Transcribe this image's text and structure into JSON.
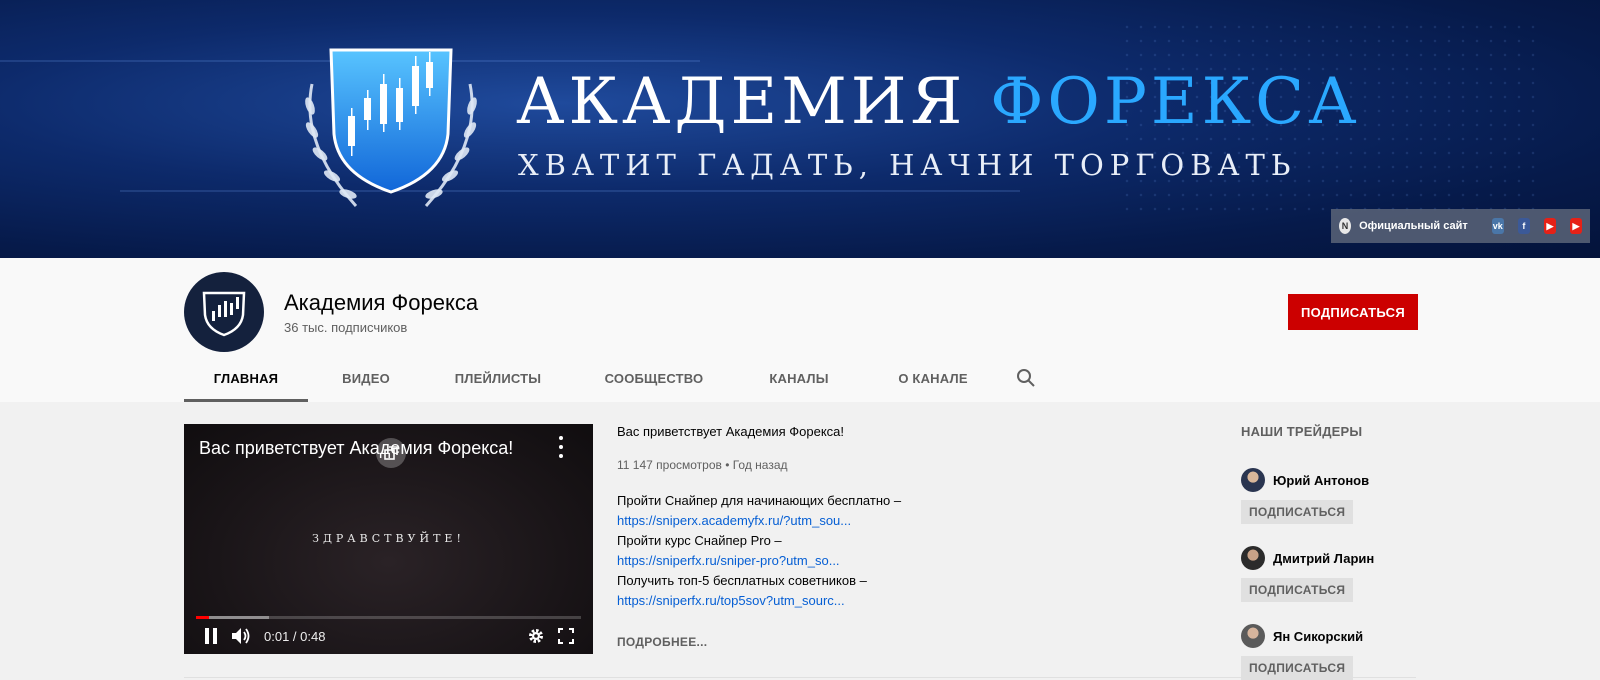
{
  "banner": {
    "title_part1": "АКАДЕМИЯ",
    "title_part2": "ФОРЕКСА",
    "slogan": "ХВАТИТ ГАДАТЬ, НАЧНИ ТОРГОВАТЬ",
    "links": {
      "official_site_label": "Официальный сайт",
      "icons": [
        "site-icon",
        "vk-icon",
        "facebook-icon",
        "youtube-icon",
        "youtube-icon"
      ]
    }
  },
  "channel": {
    "name": "Академия Форекса",
    "subscribers": "36 тыс. подписчиков",
    "subscribe_label": "ПОДПИСАТЬСЯ"
  },
  "tabs": [
    "ГЛАВНАЯ",
    "ВИДЕО",
    "ПЛЕЙЛИСТЫ",
    "СООБЩЕСТВО",
    "КАНАЛЫ",
    "О КАНАЛЕ"
  ],
  "active_tab": "ГЛАВНАЯ",
  "player": {
    "title": "Вас приветствует Академия Форекса!",
    "overlay_text": "ЗДРАВСТВУЙТЕ!",
    "time": "0:01 / 0:48",
    "progress_played": 0.035,
    "progress_buffered": 0.19
  },
  "featured": {
    "title": "Вас приветствует Академия Форекса!",
    "meta": "11 147 просмотров • Год назад",
    "lines": [
      {
        "text": "Пройти Снайпер для начинающих бесплатно –",
        "link": "https://sniperx.academyfx.ru/?utm_sou..."
      },
      {
        "text": "Пройти курс Снайпер Pro –",
        "link": "https://sniperfx.ru/sniper-pro?utm_so..."
      },
      {
        "text": "Получить топ-5 бесплатных советников –",
        "link": "https://sniperfx.ru/top5sov?utm_sourc..."
      }
    ],
    "read_more": "ПОДРОБНЕЕ..."
  },
  "sidebar": {
    "heading": "НАШИ ТРЕЙДЕРЫ",
    "traders": [
      {
        "name": "Юрий Антонов",
        "subscribe": "ПОДПИСАТЬСЯ"
      },
      {
        "name": "Дмитрий Ларин",
        "subscribe": "ПОДПИСАТЬСЯ"
      },
      {
        "name": "Ян Сикорский",
        "subscribe": "ПОДПИСАТЬСЯ"
      }
    ]
  },
  "colors": {
    "subscribe_red": "#cc0000",
    "link_blue": "#065fd4",
    "banner_accent": "#2aa8ff"
  }
}
